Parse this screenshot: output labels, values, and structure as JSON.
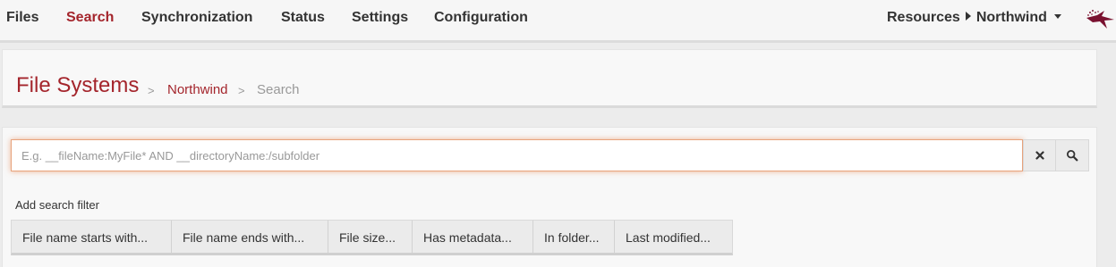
{
  "nav": {
    "items": [
      {
        "label": "Files"
      },
      {
        "label": "Search",
        "active": true
      },
      {
        "label": "Synchronization"
      },
      {
        "label": "Status"
      },
      {
        "label": "Settings"
      },
      {
        "label": "Configuration"
      }
    ],
    "resources_label": "Resources",
    "resource_name": "Northwind",
    "logo_icon": "raven-logo-icon"
  },
  "breadcrumb": {
    "title": "File Systems",
    "separator": ">",
    "link": "Northwind",
    "current": "Search"
  },
  "search": {
    "placeholder": "E.g. __fileName:MyFile* AND __directoryName:/subfolder",
    "value": "",
    "clear_icon": "close-icon",
    "search_icon": "search-icon"
  },
  "filters": {
    "label": "Add search filter",
    "buttons": [
      "File name starts with...",
      "File name ends with...",
      "File size...",
      "Has metadata...",
      "In folder...",
      "Last modified..."
    ]
  },
  "colors": {
    "accent": "#a4252c",
    "input_focus": "#e8a37c"
  }
}
